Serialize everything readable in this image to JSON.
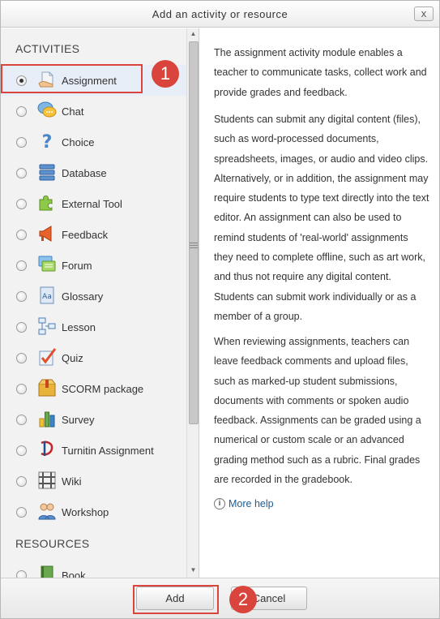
{
  "dialog": {
    "title": "Add an activity or resource",
    "close_label": "x"
  },
  "activities_heading": "ACTIVITIES",
  "resources_heading": "RESOURCES",
  "activities": [
    {
      "label": "Assignment",
      "icon": "assignment-icon",
      "selected": true
    },
    {
      "label": "Chat",
      "icon": "chat-icon"
    },
    {
      "label": "Choice",
      "icon": "choice-icon"
    },
    {
      "label": "Database",
      "icon": "database-icon"
    },
    {
      "label": "External Tool",
      "icon": "external-tool-icon"
    },
    {
      "label": "Feedback",
      "icon": "feedback-icon"
    },
    {
      "label": "Forum",
      "icon": "forum-icon"
    },
    {
      "label": "Glossary",
      "icon": "glossary-icon"
    },
    {
      "label": "Lesson",
      "icon": "lesson-icon"
    },
    {
      "label": "Quiz",
      "icon": "quiz-icon"
    },
    {
      "label": "SCORM package",
      "icon": "scorm-icon"
    },
    {
      "label": "Survey",
      "icon": "survey-icon"
    },
    {
      "label": "Turnitin Assignment",
      "icon": "turnitin-icon"
    },
    {
      "label": "Wiki",
      "icon": "wiki-icon"
    },
    {
      "label": "Workshop",
      "icon": "workshop-icon"
    }
  ],
  "resources": [
    {
      "label": "Book",
      "icon": "book-icon"
    }
  ],
  "description": {
    "p1": "The assignment activity module enables a teacher to communicate tasks, collect work and provide grades and feedback.",
    "p2": "Students can submit any digital content (files), such as word-processed documents, spreadsheets, images, or audio and video clips. Alternatively, or in addition, the assignment may require students to type text directly into the text editor. An assignment can also be used to remind students of 'real-world' assignments they need to complete offline, such as art work, and thus not require any digital content. Students can submit work individually or as a member of a group.",
    "p3": "When reviewing assignments, teachers can leave feedback comments and upload files, such as marked-up student submissions, documents with comments or spoken audio feedback. Assignments can be graded using a numerical or custom scale or an advanced grading method such as a rubric. Final grades are recorded in the gradebook.",
    "more_help": "More help"
  },
  "footer": {
    "add_label": "Add",
    "cancel_label": "Cancel"
  },
  "annotations": {
    "badge1": "1",
    "badge2": "2",
    "color": "#d9443c"
  }
}
